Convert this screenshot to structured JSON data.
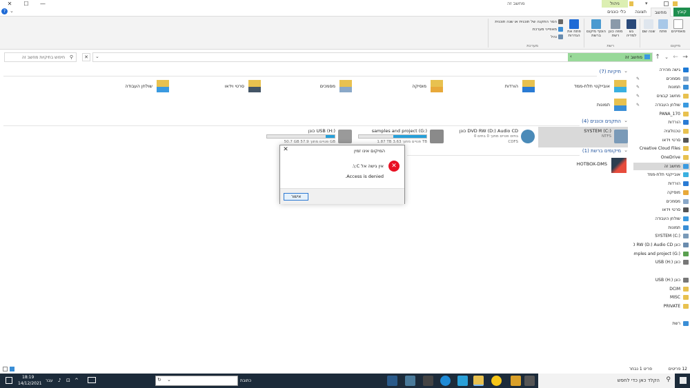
{
  "window": {
    "title": "מחשב זה",
    "context_tab": "ניהול",
    "min": "—",
    "max": "☐",
    "close": "✕",
    "help": "?"
  },
  "tabs": {
    "file": "קובץ",
    "computer": "מחשב",
    "view": "תצוגה",
    "drive_tools": "כלי כוננים"
  },
  "ribbon": {
    "properties": "מאפיינים",
    "open": "פתח",
    "rename": "שנה שם",
    "location_group": "מיקום",
    "access_media": "גש למדיה",
    "map_drive": "מפה כונן רשת",
    "add_location": "הוסף מיקום ברשת",
    "network_group": "רשת",
    "open_settings": "פתח את הגדרות",
    "uninstall": "הסר התקנה של תוכנית או שנה תוכנית",
    "system_props": "מאפייני מערכת",
    "manage": "נהל",
    "system_group": "מערכת"
  },
  "address": {
    "crumb": "מחשב זה",
    "search_placeholder": "חיפוש בתיקיות מחשב זה"
  },
  "nav": [
    {
      "label": "גישה מהירה",
      "color": "#1e7ad6",
      "pin": ""
    },
    {
      "label": "מסמכים",
      "color": "#8aa8c8",
      "pin": "✎"
    },
    {
      "label": "תמונות",
      "color": "#3a8ed6",
      "pin": "✎"
    },
    {
      "label": "מחשב קבצים",
      "color": "#e8c14f",
      "pin": "✎"
    },
    {
      "label": "שולחן העבודה",
      "color": "#3a9ae0",
      "pin": "✎"
    },
    {
      "label": "PANA_170",
      "color": "#e8c14f",
      "pin": ""
    },
    {
      "label": "הורדות",
      "color": "#2a7bd4",
      "pin": ""
    },
    {
      "label": "טכנולוגיה",
      "color": "#e8c14f",
      "pin": ""
    },
    {
      "label": "סרטי וידאו",
      "color": "#555555",
      "pin": ""
    },
    {
      "label": "Creative Cloud Files",
      "color": "#e8c14f",
      "pin": ""
    },
    {
      "label": "OneDrive",
      "color": "#e8c14f",
      "pin": ""
    },
    {
      "label": "מחשב זה",
      "color": "#3a9ae0",
      "pin": "",
      "selected": true
    },
    {
      "label": "אובייקטי תלת-ממד",
      "color": "#3ab0e0",
      "pin": ""
    },
    {
      "label": "הורדות",
      "color": "#2a7bd4",
      "pin": ""
    },
    {
      "label": "מוסיקה",
      "color": "#e8a93a",
      "pin": ""
    },
    {
      "label": "מסמכים",
      "color": "#8aa8c8",
      "pin": ""
    },
    {
      "label": "סרטי וידאו",
      "color": "#555555",
      "pin": ""
    },
    {
      "label": "שולחן העבודה",
      "color": "#3a9ae0",
      "pin": ""
    },
    {
      "label": "תמונות",
      "color": "#3a8ed6",
      "pin": ""
    },
    {
      "label": "SYSTEM (C:)",
      "color": "#7a9ab8",
      "pin": ""
    },
    {
      "label": "כונן DVD RW (D:) Audio CD",
      "color": "#6a8cae",
      "pin": ""
    },
    {
      "label": "samples and project (G:)",
      "color": "#5aa050",
      "pin": ""
    },
    {
      "label": "כונן USB (H:)",
      "color": "#777777",
      "pin": ""
    },
    {
      "label": "",
      "color": "",
      "pin": ""
    },
    {
      "label": "כונן USB (H:)",
      "color": "#777777",
      "pin": ""
    },
    {
      "label": "DCIM",
      "color": "#e8c14f",
      "pin": ""
    },
    {
      "label": "MISC",
      "color": "#e8c14f",
      "pin": ""
    },
    {
      "label": "PRIVATE",
      "color": "#e8c14f",
      "pin": ""
    },
    {
      "label": "",
      "color": "",
      "pin": ""
    },
    {
      "label": "רשת",
      "color": "#3a8ed6",
      "pin": ""
    }
  ],
  "sections": {
    "folders": "תיקיות (7)",
    "devices": "התקנים וכוננים (4)",
    "network": "מיקומים ברשת (1)"
  },
  "folders": [
    {
      "label": "אובייקטי תלת-ממד",
      "color": "#3ab0e0"
    },
    {
      "label": "הורדות",
      "color": "#2a7bd4"
    },
    {
      "label": "מוסיקה",
      "color": "#e8a93a"
    },
    {
      "label": "מסמכים",
      "color": "#8aa8c8"
    },
    {
      "label": "סרטי וידאו",
      "color": "#445566"
    },
    {
      "label": "שולחן העבודה",
      "color": "#3a9ae0"
    },
    {
      "label": "תמונות",
      "color": "#3a8ed6"
    }
  ],
  "drives": [
    {
      "name": "SYSTEM (C:)",
      "free": "NTFS",
      "fill": 0,
      "selected": true
    },
    {
      "name": "כונן DVD RW (D:) Audio CD",
      "free": "0 בתים פנויים מתוך 0 בתים",
      "extra": "CDFS",
      "fill": 0,
      "nobar": true
    },
    {
      "name": "samples and project (G:)",
      "free": "1.87 TB פנויים מתוך 3.63 TB",
      "fill": 0.49
    },
    {
      "name": "כונן USB (H:)",
      "free": "50.7 GB פנויים מתוך 57.9 GB",
      "fill": 0.13
    }
  ],
  "network_location": {
    "label": "HOTBOX-DMS"
  },
  "dialog": {
    "title": "המיקום אינו זמין",
    "msg1": "אין גישה אל C:\\.",
    "msg2": "Access is denied.",
    "ok": "אישור",
    "close": "✕",
    "error_glyph": "✕"
  },
  "status": {
    "items": "12 פריטים",
    "selected": "פריט 1 נבחר"
  },
  "taskbar": {
    "search_placeholder": "הקלד כאן כדי לחפש",
    "address_label": "כתובת",
    "time": "18:19",
    "date": "14/12/2021",
    "lang": "עבר"
  }
}
